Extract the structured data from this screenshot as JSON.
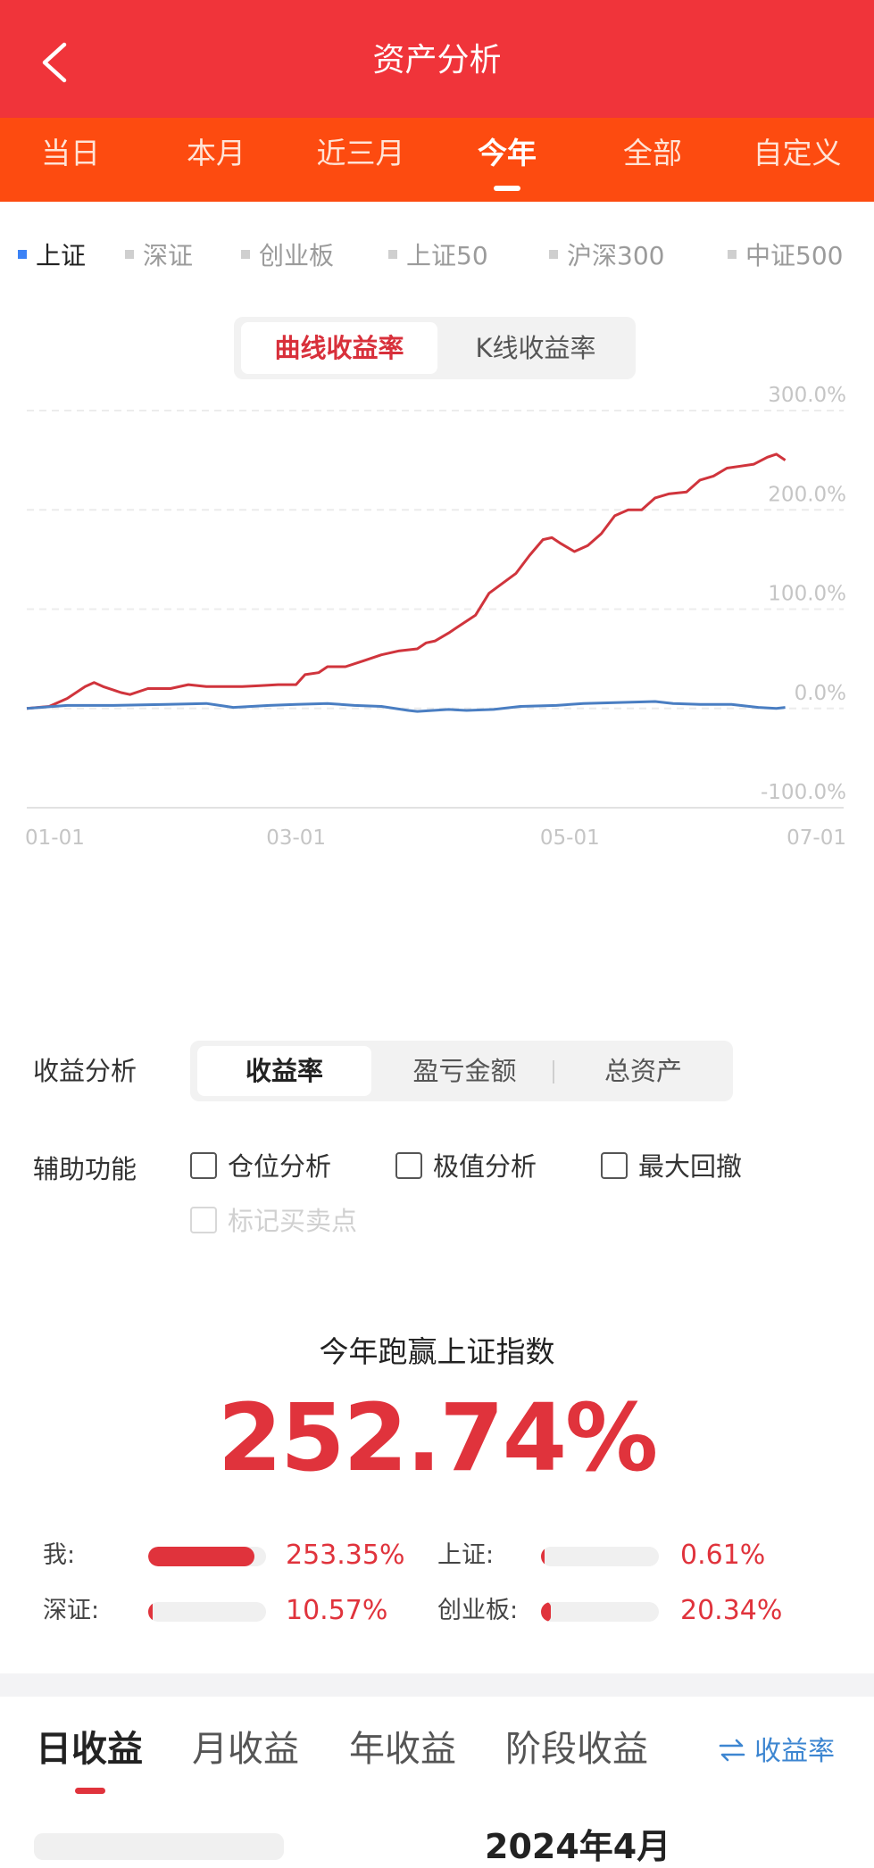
{
  "header": {
    "title": "资产分析",
    "back_icon": "chevron-left-icon"
  },
  "period_tabs": [
    {
      "label": "当日",
      "active": false
    },
    {
      "label": "本月",
      "active": false
    },
    {
      "label": "近三月",
      "active": false
    },
    {
      "label": "今年",
      "active": true
    },
    {
      "label": "全部",
      "active": false
    },
    {
      "label": "自定义",
      "active": false
    }
  ],
  "index_legend": [
    {
      "label": "上证",
      "active": true
    },
    {
      "label": "深证",
      "active": false
    },
    {
      "label": "创业板",
      "active": false
    },
    {
      "label": "上证50",
      "active": false
    },
    {
      "label": "沪深300",
      "active": false
    },
    {
      "label": "中证500",
      "active": false
    }
  ],
  "chart_mode": {
    "options": [
      "曲线收益率",
      "K线收益率"
    ],
    "selected": 0
  },
  "chart_data": {
    "type": "line",
    "title": "",
    "xlabel": "",
    "ylabel": "",
    "x_ticks": [
      "01-01",
      "03-01",
      "05-01",
      "07-01"
    ],
    "y_ticks": [
      "300.0%",
      "200.0%",
      "100.0%",
      "0.0%",
      "-100.0%"
    ],
    "ylim": [
      -100,
      300
    ],
    "grid": true,
    "series": [
      {
        "color": "#d0343c",
        "points": [
          [
            "01-01",
            0
          ],
          [
            "01-06",
            2
          ],
          [
            "01-10",
            10
          ],
          [
            "01-14",
            22
          ],
          [
            "01-16",
            26
          ],
          [
            "01-18",
            22
          ],
          [
            "01-22",
            16
          ],
          [
            "01-24",
            14
          ],
          [
            "01-28",
            20
          ],
          [
            "02-02",
            20
          ],
          [
            "02-06",
            24
          ],
          [
            "02-10",
            22
          ],
          [
            "02-14",
            22
          ],
          [
            "02-18",
            22
          ],
          [
            "02-22",
            23
          ],
          [
            "02-26",
            24
          ],
          [
            "03-01",
            24
          ],
          [
            "03-03",
            34
          ],
          [
            "03-06",
            36
          ],
          [
            "03-08",
            42
          ],
          [
            "03-12",
            42
          ],
          [
            "03-16",
            48
          ],
          [
            "03-20",
            54
          ],
          [
            "03-24",
            58
          ],
          [
            "03-28",
            60
          ],
          [
            "03-30",
            66
          ],
          [
            "04-01",
            68
          ],
          [
            "04-04",
            76
          ],
          [
            "04-06",
            82
          ],
          [
            "04-10",
            94
          ],
          [
            "04-13",
            116
          ],
          [
            "04-16",
            126
          ],
          [
            "04-19",
            136
          ],
          [
            "04-22",
            154
          ],
          [
            "04-25",
            170
          ],
          [
            "04-27",
            172
          ],
          [
            "04-29",
            166
          ],
          [
            "05-02",
            158
          ],
          [
            "05-05",
            164
          ],
          [
            "05-08",
            176
          ],
          [
            "05-11",
            194
          ],
          [
            "05-14",
            200
          ],
          [
            "05-17",
            200
          ],
          [
            "05-20",
            212
          ],
          [
            "05-23",
            216
          ],
          [
            "05-27",
            218
          ],
          [
            "05-30",
            230
          ],
          [
            "06-02",
            234
          ],
          [
            "06-05",
            242
          ],
          [
            "06-08",
            244
          ],
          [
            "06-11",
            246
          ],
          [
            "06-14",
            253
          ],
          [
            "06-16",
            256
          ],
          [
            "06-18",
            250
          ]
        ]
      },
      {
        "color": "#4a7ec2",
        "points": [
          [
            "01-01",
            0
          ],
          [
            "01-10",
            3
          ],
          [
            "01-20",
            3
          ],
          [
            "02-01",
            4
          ],
          [
            "02-10",
            5
          ],
          [
            "02-16",
            1
          ],
          [
            "02-24",
            3
          ],
          [
            "03-01",
            4
          ],
          [
            "03-08",
            5
          ],
          [
            "03-14",
            3
          ],
          [
            "03-20",
            2
          ],
          [
            "03-26",
            -2
          ],
          [
            "03-28",
            -3
          ],
          [
            "04-04",
            -1
          ],
          [
            "04-08",
            -2
          ],
          [
            "04-14",
            -1
          ],
          [
            "04-20",
            2
          ],
          [
            "04-28",
            3
          ],
          [
            "05-04",
            5
          ],
          [
            "05-12",
            6
          ],
          [
            "05-20",
            7
          ],
          [
            "05-24",
            5
          ],
          [
            "05-30",
            4
          ],
          [
            "06-06",
            4
          ],
          [
            "06-12",
            1
          ],
          [
            "06-16",
            0
          ],
          [
            "06-18",
            1
          ]
        ]
      }
    ]
  },
  "analysis": {
    "label": "收益分析",
    "options": [
      "收益率",
      "盈亏金额",
      "总资产"
    ],
    "selected": 0
  },
  "aux": {
    "label": "辅助功能",
    "options": [
      {
        "label": "仓位分析",
        "checked": false,
        "disabled": false
      },
      {
        "label": "极值分析",
        "checked": false,
        "disabled": false
      },
      {
        "label": "最大回撤",
        "checked": false,
        "disabled": false
      },
      {
        "label": "标记买卖点",
        "checked": false,
        "disabled": true
      }
    ]
  },
  "summary": {
    "title": "今年跑赢上证指数",
    "value": "252.74%",
    "comparisons": [
      {
        "label": "我:",
        "value": "253.35%",
        "bar_fraction": 0.9
      },
      {
        "label": "上证:",
        "value": "0.61%",
        "bar_fraction": 0.005
      },
      {
        "label": "深证:",
        "value": "10.57%",
        "bar_fraction": 0.04
      },
      {
        "label": "创业板:",
        "value": "20.34%",
        "bar_fraction": 0.08
      }
    ]
  },
  "bottom_tabs": {
    "tabs": [
      {
        "label": "日收益",
        "active": true
      },
      {
        "label": "月收益",
        "active": false
      },
      {
        "label": "年收益",
        "active": false
      },
      {
        "label": "阶段收益",
        "active": false
      }
    ],
    "toggle_label": "收益率",
    "toggle_icon": "swap-arrows-icon"
  },
  "peek": {
    "text": "2024年4月"
  }
}
